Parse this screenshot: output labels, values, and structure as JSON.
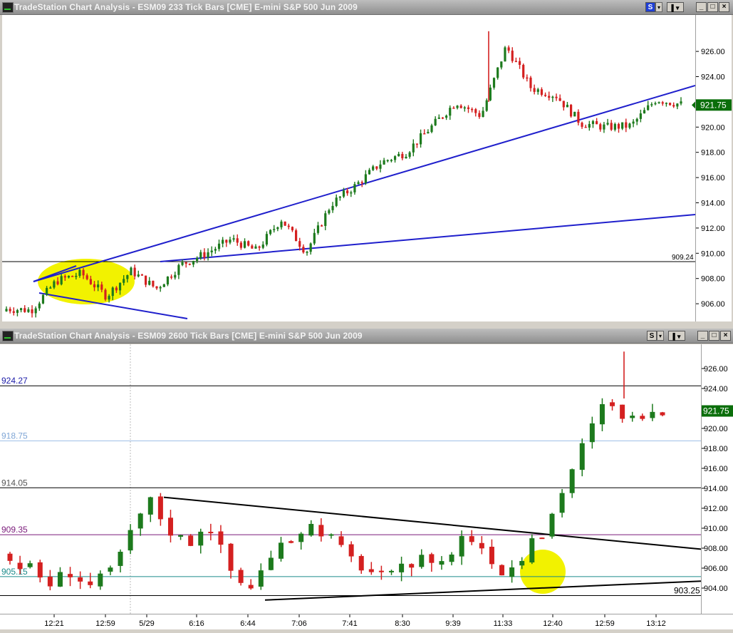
{
  "top_window": {
    "title": "TradeStation Chart Analysis - ESM09  233 Tick Bars [CME] E-mini S&P 500 Jun 2009",
    "symbol_button": "S",
    "last_price": "921.75",
    "hline_label": "909.24",
    "y_ticks": [
      "926.00",
      "924.00",
      "922.00",
      "920.00",
      "918.00",
      "916.00",
      "914.00",
      "912.00",
      "910.00",
      "908.00",
      "906.00"
    ]
  },
  "bottom_window": {
    "title": "TradeStation Chart Analysis - ESM09  2600 Tick Bars [CME] E-mini S&P 500 Jun 2009",
    "symbol_button": "S",
    "last_price": "921.75",
    "y_ticks": [
      "926.00",
      "924.00",
      "922.00",
      "920.00",
      "918.00",
      "916.00",
      "914.00",
      "912.00",
      "910.00",
      "908.00",
      "906.00",
      "904.00"
    ],
    "level_labels": [
      {
        "text": "924.27",
        "color": "#1c1ca8"
      },
      {
        "text": "918.75",
        "color": "#7fa6d6"
      },
      {
        "text": "914.05",
        "color": "#555555"
      },
      {
        "text": "909.35",
        "color": "#7a1a7a"
      },
      {
        "text": "905.15",
        "color": "#1a8a8a"
      },
      {
        "text": "903.25",
        "color": "#000000"
      }
    ],
    "x_labels": [
      "12:21",
      "12:59",
      "5/29",
      "6:16",
      "6:44",
      "7:06",
      "7:41",
      "8:30",
      "9:39",
      "11:33",
      "12:40",
      "12:59",
      "13:12"
    ]
  },
  "colors": {
    "up": "#1d7a1d",
    "down": "#d42020",
    "trend_blue": "#1f1fcc",
    "highlight": "#f2f200",
    "price_box": "#0a6e0a"
  }
}
